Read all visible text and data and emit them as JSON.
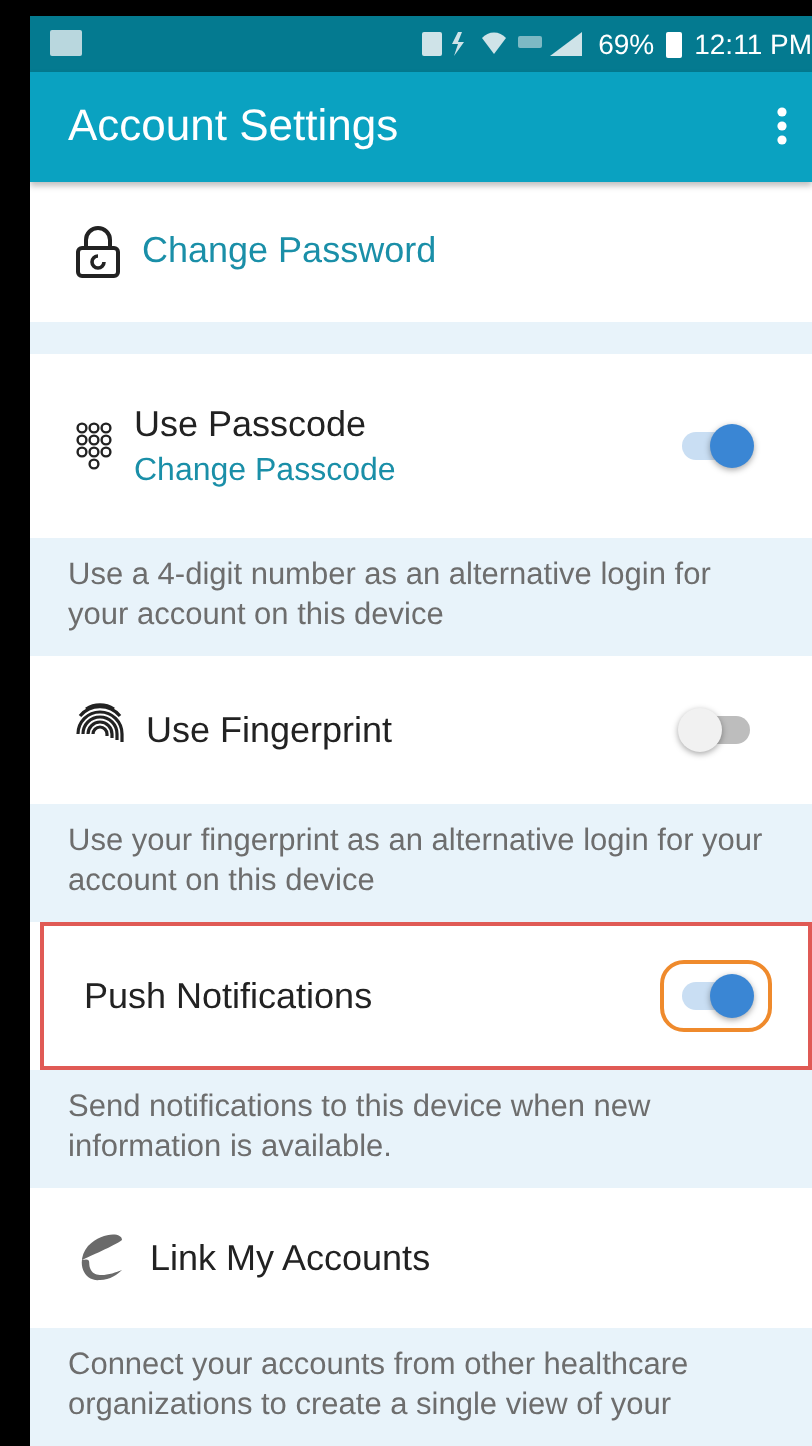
{
  "status_bar": {
    "battery": "69%",
    "time": "12:11 PM"
  },
  "app_bar": {
    "title": "Account Settings"
  },
  "items": [
    {
      "kind": "link",
      "label": "Change Password"
    },
    {
      "kind": "gap"
    },
    {
      "kind": "toggle",
      "label": "Use Passcode",
      "sublabel": "Change Passcode",
      "on": true,
      "highlighted": false
    },
    {
      "kind": "desc",
      "text": "Use a 4-digit number as an alternative login for your account on this device"
    },
    {
      "kind": "toggle",
      "label": "Use Fingerprint",
      "on": false,
      "highlighted": false
    },
    {
      "kind": "desc",
      "text": "Use your fingerprint as an alternative login for your account on this device"
    },
    {
      "kind": "toggle",
      "label": "Push Notifications",
      "on": true,
      "highlighted": true
    },
    {
      "kind": "desc",
      "text": "Send notifications to this device when new information is available."
    },
    {
      "kind": "item",
      "label": "Link My Accounts"
    },
    {
      "kind": "desc",
      "text": "Connect your accounts from other healthcare organizations to create a single view of your"
    }
  ]
}
